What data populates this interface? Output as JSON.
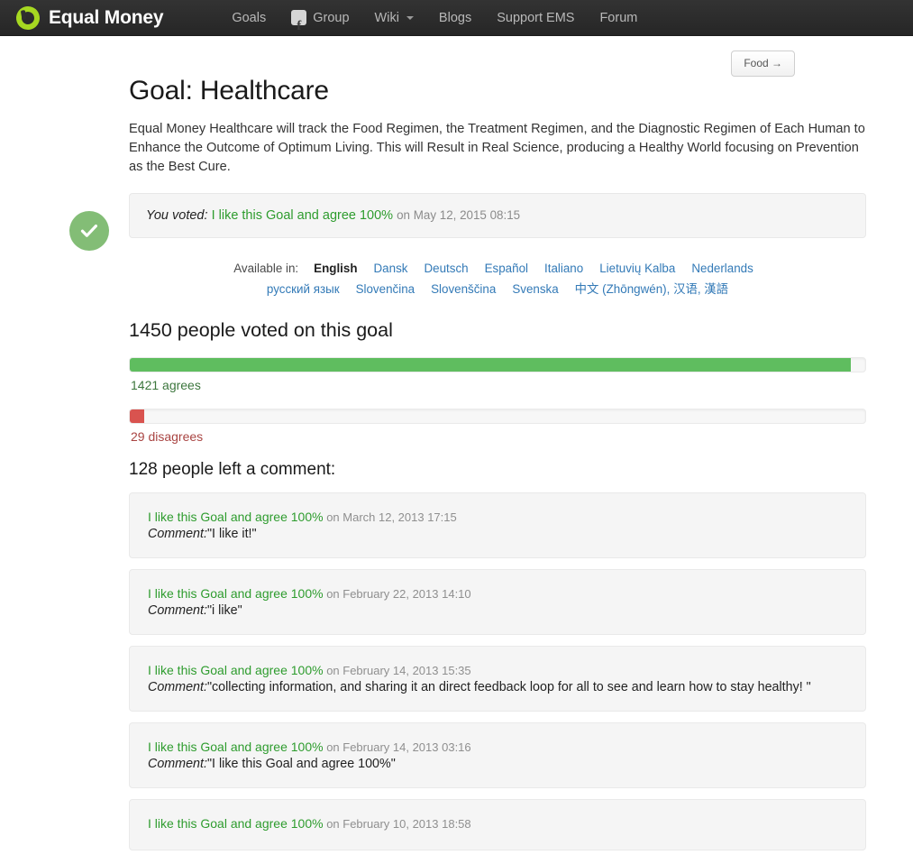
{
  "header": {
    "brand": "Equal Money",
    "brand_logo_icon": "green-ring-logo",
    "nav": [
      {
        "label": "Goals",
        "icon": null
      },
      {
        "label": "Group",
        "icon": "facebook-icon"
      },
      {
        "label": "Wiki",
        "icon": "chevron-down-icon"
      },
      {
        "label": "Blogs",
        "icon": null
      },
      {
        "label": "Support EMS",
        "icon": null
      },
      {
        "label": "Forum",
        "icon": null
      }
    ]
  },
  "toolbar": {
    "food_button": "Food →"
  },
  "goal": {
    "status_icon": "check-circle-icon",
    "title": "Goal: Healthcare",
    "description": "Equal Money Healthcare will track the Food Regimen, the Treatment Regimen, and the Diagnostic Regimen of Each Human to Enhance the Outcome of Optimum Living. This will Result in Real Science, producing a Healthy World focusing on Prevention as the Best Cure."
  },
  "you_voted": {
    "label": "You voted:",
    "vote_text": "I like this Goal and agree 100%",
    "date": "on May 12, 2015 08:15"
  },
  "languages": {
    "label": "Available in:",
    "current": "English",
    "items": [
      "Dansk",
      "Deutsch",
      "Español",
      "Italiano",
      "Lietuvių Kalba",
      "Nederlands",
      "русский язык",
      "Slovenčina",
      "Slovenščina",
      "Svenska",
      "中文 (Zhōngwén), 汉语, 漢語"
    ]
  },
  "votes": {
    "heading": "1450 people voted on this goal",
    "total": 1450,
    "agree_caption": "1421 agrees",
    "agree_count": 1421,
    "agree_percent": 98,
    "disagree_caption": "29 disagrees",
    "disagree_count": 29,
    "disagree_percent": 2,
    "agree_color": "#5fbd5f",
    "disagree_color": "#d9534f"
  },
  "comments": {
    "heading": "128 people left a comment:",
    "count": 128,
    "label": "Comment:",
    "items": [
      {
        "vote": "I like this Goal and agree 100%",
        "date": "on March 12, 2013 17:15",
        "text": "\"I like it!\""
      },
      {
        "vote": "I like this Goal and agree 100%",
        "date": "on February 22, 2013 14:10",
        "text": "\"i like\""
      },
      {
        "vote": "I like this Goal and agree 100%",
        "date": "on February 14, 2013 15:35",
        "text": "\"collecting information, and sharing it an direct feedback loop for all to see and learn how to stay healthy! \""
      },
      {
        "vote": "I like this Goal and agree 100%",
        "date": "on February 14, 2013 03:16",
        "text": "\"I like this Goal and agree 100%\""
      },
      {
        "vote": "I like this Goal and agree 100%",
        "date": "on February 10, 2013 18:58",
        "text": ""
      }
    ]
  }
}
